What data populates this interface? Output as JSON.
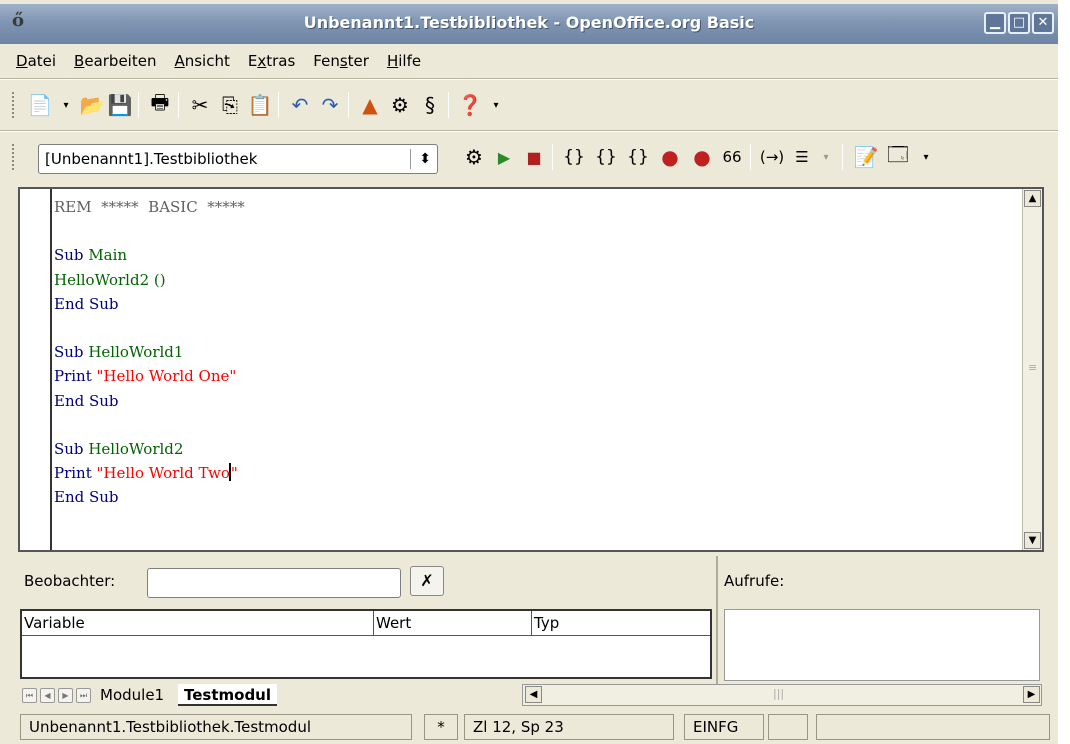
{
  "window": {
    "title": "Unbenannt1.Testbibliothek - OpenOffice.org Basic",
    "app_icon": "openoffice-icon",
    "controls": [
      "minimize",
      "maximize",
      "close"
    ]
  },
  "menu": {
    "items": [
      {
        "pre": "",
        "u": "D",
        "post": "atei"
      },
      {
        "pre": "",
        "u": "B",
        "post": "earbeiten"
      },
      {
        "pre": "",
        "u": "A",
        "post": "nsicht"
      },
      {
        "pre": "E",
        "u": "x",
        "post": "tras"
      },
      {
        "pre": "Fen",
        "u": "s",
        "post": "ter"
      },
      {
        "pre": "",
        "u": "H",
        "post": "ilfe"
      }
    ]
  },
  "toolbar2": {
    "library": "[Unbenannt1].Testbibliothek"
  },
  "code_lines": [
    [
      {
        "t": "REM  *****  BASIC  *****",
        "c": "com"
      }
    ],
    [],
    [
      {
        "t": "Sub ",
        "c": "kw"
      },
      {
        "t": "Main",
        "c": "id"
      }
    ],
    [
      {
        "t": "HelloWorld2 ()",
        "c": "id"
      }
    ],
    [
      {
        "t": "End Sub",
        "c": "kw"
      }
    ],
    [],
    [
      {
        "t": "Sub ",
        "c": "kw"
      },
      {
        "t": "HelloWorld1",
        "c": "id"
      }
    ],
    [
      {
        "t": "Print ",
        "c": "kw"
      },
      {
        "t": "\"Hello World One\"",
        "c": "str"
      }
    ],
    [
      {
        "t": "End Sub",
        "c": "kw"
      }
    ],
    [],
    [
      {
        "t": "Sub ",
        "c": "kw"
      },
      {
        "t": "HelloWorld2",
        "c": "id"
      }
    ],
    [
      {
        "t": "Print ",
        "c": "kw"
      },
      {
        "t": "\"Hello World Two",
        "c": "str"
      },
      {
        "t": "|caret|",
        "c": "caret"
      },
      {
        "t": "\"",
        "c": "str"
      }
    ],
    [
      {
        "t": "End Sub",
        "c": "kw"
      }
    ]
  ],
  "watch": {
    "label": "Beobachter:",
    "value": "",
    "columns": [
      "Variable",
      "Wert",
      "Typ"
    ]
  },
  "calls": {
    "label": "Aufrufe:"
  },
  "tabs": {
    "items": [
      "Module1",
      "Testmodul"
    ],
    "active": "Testmodul"
  },
  "status": {
    "module": "Unbenannt1.Testbibliothek.Testmodul",
    "modified": "*",
    "position": "Zl 12, Sp 23",
    "mode": "EINFG",
    "extra1": "",
    "extra2": ""
  },
  "colors": {
    "keyword": "#000080",
    "identifier": "#006400",
    "string": "#ff0000",
    "comment": "#606060"
  }
}
